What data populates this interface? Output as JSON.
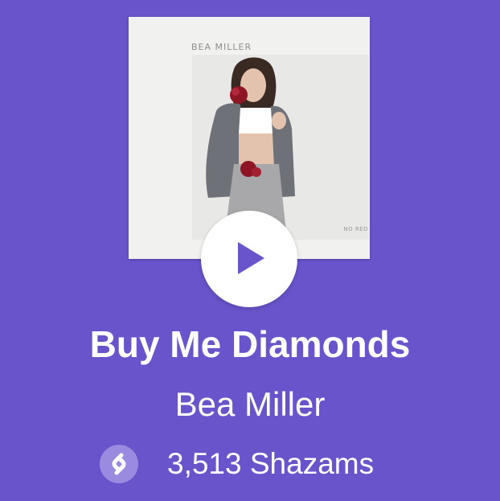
{
  "track": {
    "title": "Buy Me Diamonds",
    "artist": "Bea Miller",
    "shazam_count": "3,513 Shazams"
  },
  "album_art": {
    "artist_mark": "BEA MILLER",
    "album_mark": "NO RED"
  },
  "icons": {
    "play": "play-icon",
    "shazam": "shazam-logo-icon"
  },
  "colors": {
    "background": "#6a54cc",
    "play_triangle": "#6a54cc",
    "shazam_badge": "#9b8be0",
    "text": "#ffffff"
  }
}
